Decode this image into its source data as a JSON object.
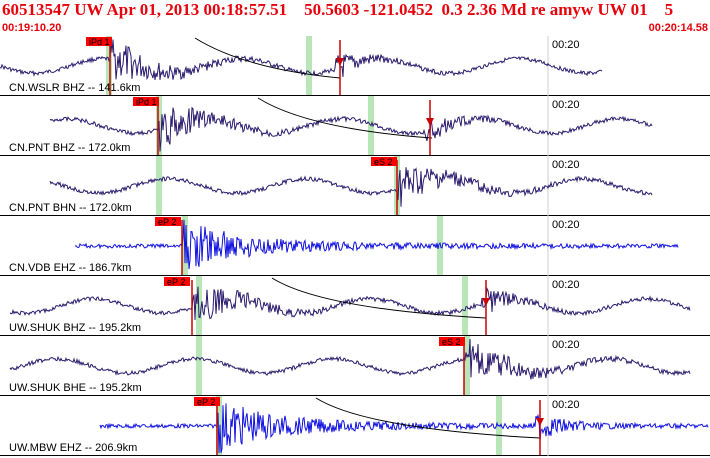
{
  "header": {
    "title": "60513547 UW Apr 01, 2013 00:18:57.51    50.5603 -121.0452  0.3 2.36 Md re amyw UW 01    5",
    "time_start": "00:19:10.20",
    "time_end": "00:20:14.58"
  },
  "colors": {
    "header_text": "#e8000b",
    "broadband_trace": "#2a1a6e",
    "short_period_trace": "#1010e0",
    "pick_box": "#ff0000",
    "pick_line": "#cc0000",
    "window_band": "#b8e6b8",
    "grid_line": "#cfcfcf"
  },
  "minute_tick_label": "00:20",
  "traces": [
    {
      "label": "CN.WSLR BHZ -- 141.6km",
      "pick": "iPd 1",
      "color_type": "broadband",
      "has_curve": true,
      "has_s_marker": true
    },
    {
      "label": "CN.PNT BHZ -- 172.0km",
      "pick": "iPd 1",
      "color_type": "broadband",
      "has_curve": true,
      "has_s_marker": true
    },
    {
      "label": "CN.PNT BHN -- 172.0km",
      "pick": "eS 2",
      "color_type": "broadband",
      "has_curve": false,
      "has_s_marker": false
    },
    {
      "label": "CN.VDB EHZ -- 186.7km",
      "pick": "eP 2",
      "color_type": "short",
      "has_curve": false,
      "has_s_marker": false
    },
    {
      "label": "UW.SHUK BHZ -- 195.2km",
      "pick": "eP 2",
      "color_type": "broadband",
      "has_curve": true,
      "has_s_marker": true
    },
    {
      "label": "UW.SHUK BHE -- 195.2km",
      "pick": "eS 2",
      "color_type": "broadband",
      "has_curve": false,
      "has_s_marker": false
    },
    {
      "label": "UW.MBW EHZ -- 206.9km",
      "pick": "eP 2",
      "color_type": "short",
      "has_curve": true,
      "has_s_marker": true
    }
  ]
}
